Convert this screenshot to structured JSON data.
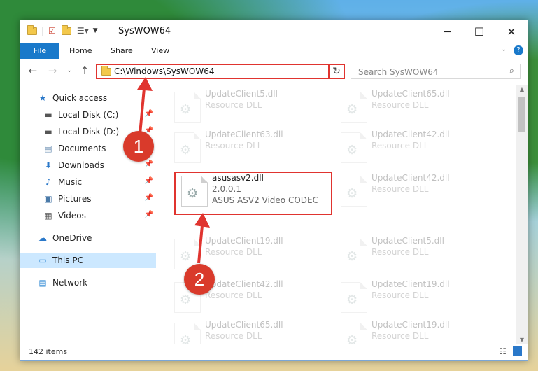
{
  "window": {
    "title": "SysWOW64"
  },
  "ribbon": {
    "tabs": [
      "File",
      "Home",
      "Share",
      "View"
    ]
  },
  "address": {
    "path": "C:\\Windows\\SysWOW64"
  },
  "search": {
    "placeholder": "Search SysWOW64"
  },
  "nav": {
    "quick_access": "Quick access",
    "items": [
      {
        "label": "Local Disk (C:)",
        "icon": "drive-icon"
      },
      {
        "label": "Local Disk (D:)",
        "icon": "drive-icon"
      },
      {
        "label": "Documents",
        "icon": "documents-icon"
      },
      {
        "label": "Downloads",
        "icon": "downloads-icon"
      },
      {
        "label": "Music",
        "icon": "music-icon"
      },
      {
        "label": "Pictures",
        "icon": "pictures-icon"
      },
      {
        "label": "Videos",
        "icon": "videos-icon"
      }
    ],
    "onedrive": "OneDrive",
    "this_pc": "This PC",
    "network": "Network"
  },
  "files": {
    "left": [
      {
        "name": "UpdateClient5.dll",
        "desc": "Resource DLL"
      },
      {
        "name": "UpdateClient63.dll",
        "desc": "Resource DLL"
      },
      {
        "name": "asusasv2.dll",
        "version": "2.0.0.1",
        "desc": "ASUS ASV2 Video CODEC"
      },
      {
        "name": "UpdateClient19.dll",
        "desc": "Resource DLL"
      },
      {
        "name": "UpdateClient42.dll",
        "desc": "Resource DLL"
      },
      {
        "name": "UpdateClient65.dll",
        "desc": "Resource DLL"
      }
    ],
    "right": [
      {
        "name": "UpdateClient65.dll",
        "desc": "Resource DLL"
      },
      {
        "name": "UpdateClient42.dll",
        "desc": "Resource DLL"
      },
      {
        "name": "UpdateClient42.dll",
        "desc": "Resource DLL"
      },
      {
        "name": "UpdateClient5.dll",
        "desc": "Resource DLL"
      },
      {
        "name": "UpdateClient19.dll",
        "desc": "Resource DLL"
      },
      {
        "name": "UpdateClient19.dll",
        "desc": "Resource DLL"
      }
    ]
  },
  "status": {
    "count": "142 items"
  },
  "annotations": {
    "step1": "1",
    "step2": "2"
  },
  "colors": {
    "accent": "#1979ca",
    "highlight": "#e0342f",
    "selected": "#cce8ff"
  }
}
